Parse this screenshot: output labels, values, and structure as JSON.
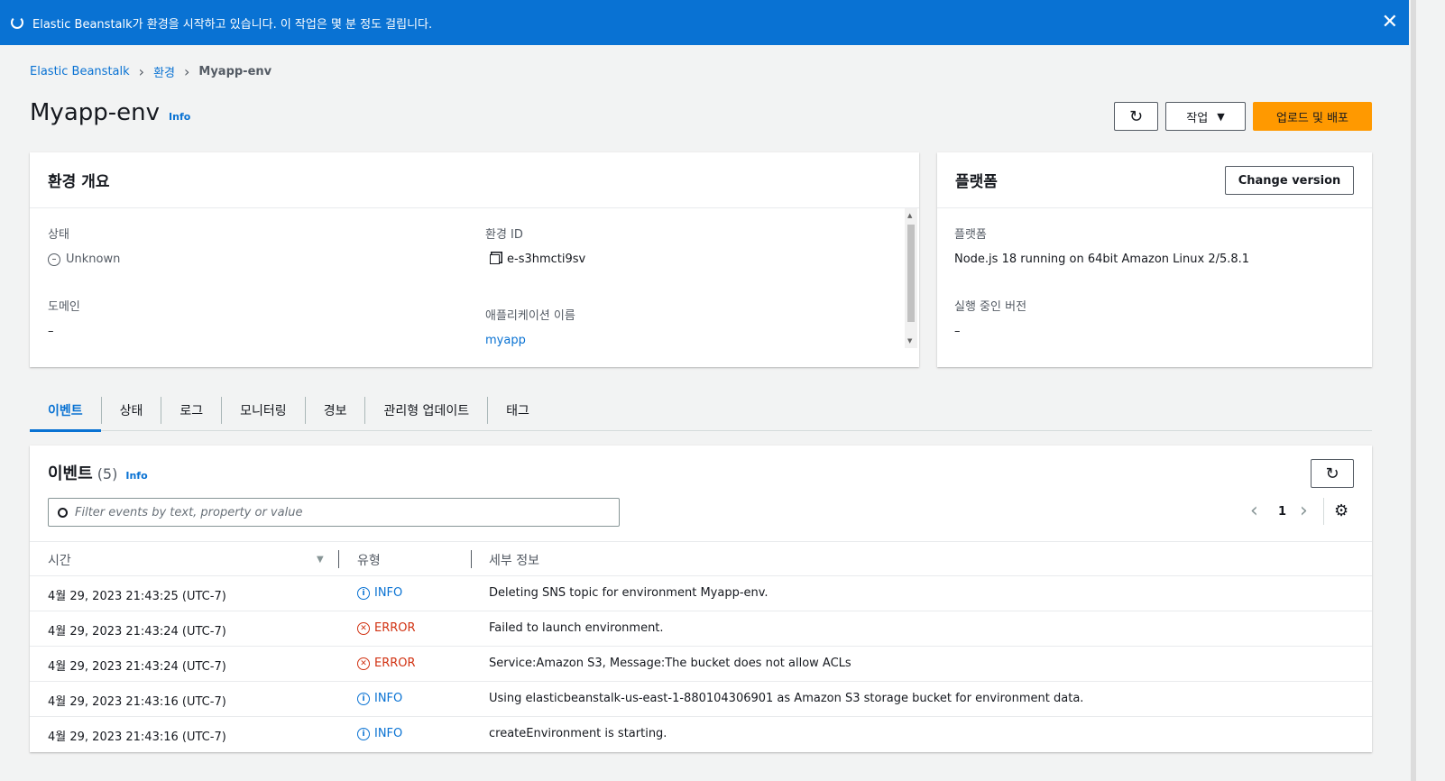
{
  "banner": {
    "message": "Elastic Beanstalk가 환경을 시작하고 있습니다. 이 작업은 몇 분 정도 걸립니다.",
    "close_glyph": "✕"
  },
  "breadcrumb": {
    "items": [
      "Elastic Beanstalk",
      "환경"
    ],
    "current": "Myapp-env"
  },
  "header": {
    "title": "Myapp-env",
    "info": "Info",
    "refresh_glyph": "↻",
    "actions_label": "작업",
    "actions_arrow": "▼",
    "primary_label": "업로드 및 배포"
  },
  "overview": {
    "title": "환경 개요",
    "status_label": "상태",
    "status_value": "Unknown",
    "domain_label": "도메인",
    "domain_value": "–",
    "env_id_label": "환경 ID",
    "env_id_value": "e-s3hmcti9sv",
    "app_name_label": "애플리케이션 이름",
    "app_name_value": "myapp"
  },
  "platform": {
    "title": "플랫폼",
    "change_label": "Change version",
    "platform_label": "플랫폼",
    "platform_value": "Node.js 18 running on 64bit Amazon Linux 2/5.8.1",
    "version_label": "실행 중인 버전",
    "version_value": "–"
  },
  "tabs": [
    "이벤트",
    "상태",
    "로그",
    "모니터링",
    "경보",
    "관리형 업데이트",
    "태그"
  ],
  "events": {
    "title": "이벤트",
    "count": "(5)",
    "info": "Info",
    "search_placeholder": "Filter events by text, property or value",
    "page": "1",
    "prev": "‹",
    "next": "›",
    "settings_glyph": "⚙",
    "columns": [
      "시간",
      "유형",
      "세부 정보"
    ],
    "rows": [
      {
        "time": "4월 29, 2023 21:43:25 (UTC-7)",
        "type": "INFO",
        "detail": "Deleting SNS topic for environment Myapp-env."
      },
      {
        "time": "4월 29, 2023 21:43:24 (UTC-7)",
        "type": "ERROR",
        "detail": "Failed to launch environment."
      },
      {
        "time": "4월 29, 2023 21:43:24 (UTC-7)",
        "type": "ERROR",
        "detail": "Service:Amazon S3, Message:The bucket does not allow ACLs"
      },
      {
        "time": "4월 29, 2023 21:43:16 (UTC-7)",
        "type": "INFO",
        "detail": "Using elasticbeanstalk-us-east-1-880104306901 as Amazon S3 storage bucket for environment data."
      },
      {
        "time": "4월 29, 2023 21:43:16 (UTC-7)",
        "type": "INFO",
        "detail": "createEnvironment is starting."
      }
    ]
  }
}
